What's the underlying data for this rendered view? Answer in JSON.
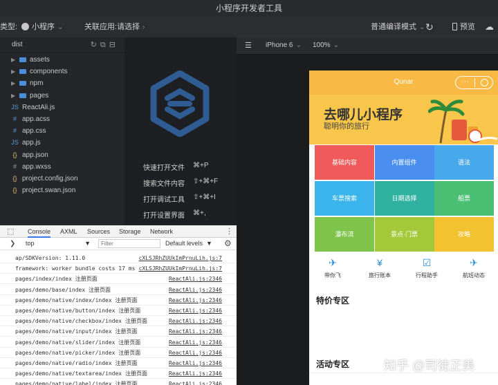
{
  "window": {
    "title": "小程序开发者工具"
  },
  "toolbar": {
    "type_label": "类型:",
    "type_value": "小程序",
    "related_label": "关联应用:",
    "related_value": "请选择",
    "compile_mode": "普通编译模式",
    "preview_label": "预览"
  },
  "tree": {
    "root": "dist",
    "items": [
      {
        "name": "assets",
        "kind": "folder"
      },
      {
        "name": "components",
        "kind": "folder"
      },
      {
        "name": "npm",
        "kind": "folder"
      },
      {
        "name": "pages",
        "kind": "folder"
      },
      {
        "name": "ReactAli.js",
        "kind": "js"
      },
      {
        "name": "app.acss",
        "kind": "css"
      },
      {
        "name": "app.css",
        "kind": "css"
      },
      {
        "name": "app.js",
        "kind": "js"
      },
      {
        "name": "app.json",
        "kind": "json"
      },
      {
        "name": "app.wxss",
        "kind": "wxss"
      },
      {
        "name": "project.config.json",
        "kind": "json"
      },
      {
        "name": "project.swan.json",
        "kind": "json"
      }
    ]
  },
  "shortcuts": [
    {
      "label": "快速打开文件",
      "key": "⌘+P"
    },
    {
      "label": "搜索文件内容",
      "key": "⇧+⌘+F"
    },
    {
      "label": "打开调试工具",
      "key": "⇧+⌘+I"
    },
    {
      "label": "打开设置界面",
      "key": "⌘+,"
    }
  ],
  "console": {
    "tabs": [
      "Console",
      "AXML",
      "Sources",
      "Storage",
      "Network"
    ],
    "context": "top",
    "filter_placeholder": "Filter",
    "levels": "Default levels",
    "rows": [
      {
        "msg": "ap/SDKVersion: 1.11.0",
        "src": "cXLSJRhZUUkImPrnuLih.js:7"
      },
      {
        "msg": "framework: worker bundle costs 17 ms",
        "src": "cXLSJRhZUUkImPrnuLih.js:7"
      },
      {
        "msg": "pages/index/index 注册页面",
        "src": "ReactAli.js:2346"
      },
      {
        "msg": "pages/demo/base/index 注册页面",
        "src": "ReactAli.js:2346"
      },
      {
        "msg": "pages/demo/native/index/index 注册页面",
        "src": "ReactAli.js:2346"
      },
      {
        "msg": "pages/demo/native/button/index 注册页面",
        "src": "ReactAli.js:2346"
      },
      {
        "msg": "pages/demo/native/checkbox/index 注册页面",
        "src": "ReactAli.js:2346"
      },
      {
        "msg": "pages/demo/native/input/index 注册页面",
        "src": "ReactAli.js:2346"
      },
      {
        "msg": "pages/demo/native/slider/index 注册页面",
        "src": "ReactAli.js:2346"
      },
      {
        "msg": "pages/demo/native/picker/index 注册页面",
        "src": "ReactAli.js:2346"
      },
      {
        "msg": "pages/demo/native/radio/index 注册页面",
        "src": "ReactAli.js:2346"
      },
      {
        "msg": "pages/demo/native/textarea/index 注册页面",
        "src": "ReactAli.js:2346"
      },
      {
        "msg": "pages/demo/native/label/index 注册页面",
        "src": "ReactAli.js:2346"
      }
    ]
  },
  "simulator": {
    "device": "iPhone 6",
    "zoom": "100%"
  },
  "app": {
    "nav_title": "Qunar",
    "nav_dots": "···",
    "banner_title": "去哪儿小程序",
    "banner_sub": "聪明你的旅行",
    "grid": [
      {
        "label": "基础内容",
        "color": "#f05a5a"
      },
      {
        "label": "内置组件",
        "color": "#4a8ff0"
      },
      {
        "label": "语法",
        "color": "#47a8ec"
      },
      {
        "label": "车票搜索",
        "color": "#3ab4ea"
      },
      {
        "label": "日期选择",
        "color": "#2fb1a0"
      },
      {
        "label": "船票",
        "color": "#4bbf73"
      },
      {
        "label": "瀑布流",
        "color": "#7ec44a"
      },
      {
        "label": "景点·门票",
        "color": "#a3c93a"
      },
      {
        "label": "攻略",
        "color": "#f3c231"
      }
    ],
    "icons": [
      {
        "label": "带你飞",
        "glyph": "✈",
        "name": "plane-icon"
      },
      {
        "label": "旅行账本",
        "glyph": "¥",
        "name": "ledger-icon"
      },
      {
        "label": "行程助手",
        "glyph": "☑",
        "name": "calendar-icon"
      },
      {
        "label": "航班动态",
        "glyph": "✈",
        "name": "flight-icon"
      }
    ],
    "special_title": "特价专区",
    "activity_title": "活动专区",
    "watermark": "知乎 @司徒正美"
  }
}
